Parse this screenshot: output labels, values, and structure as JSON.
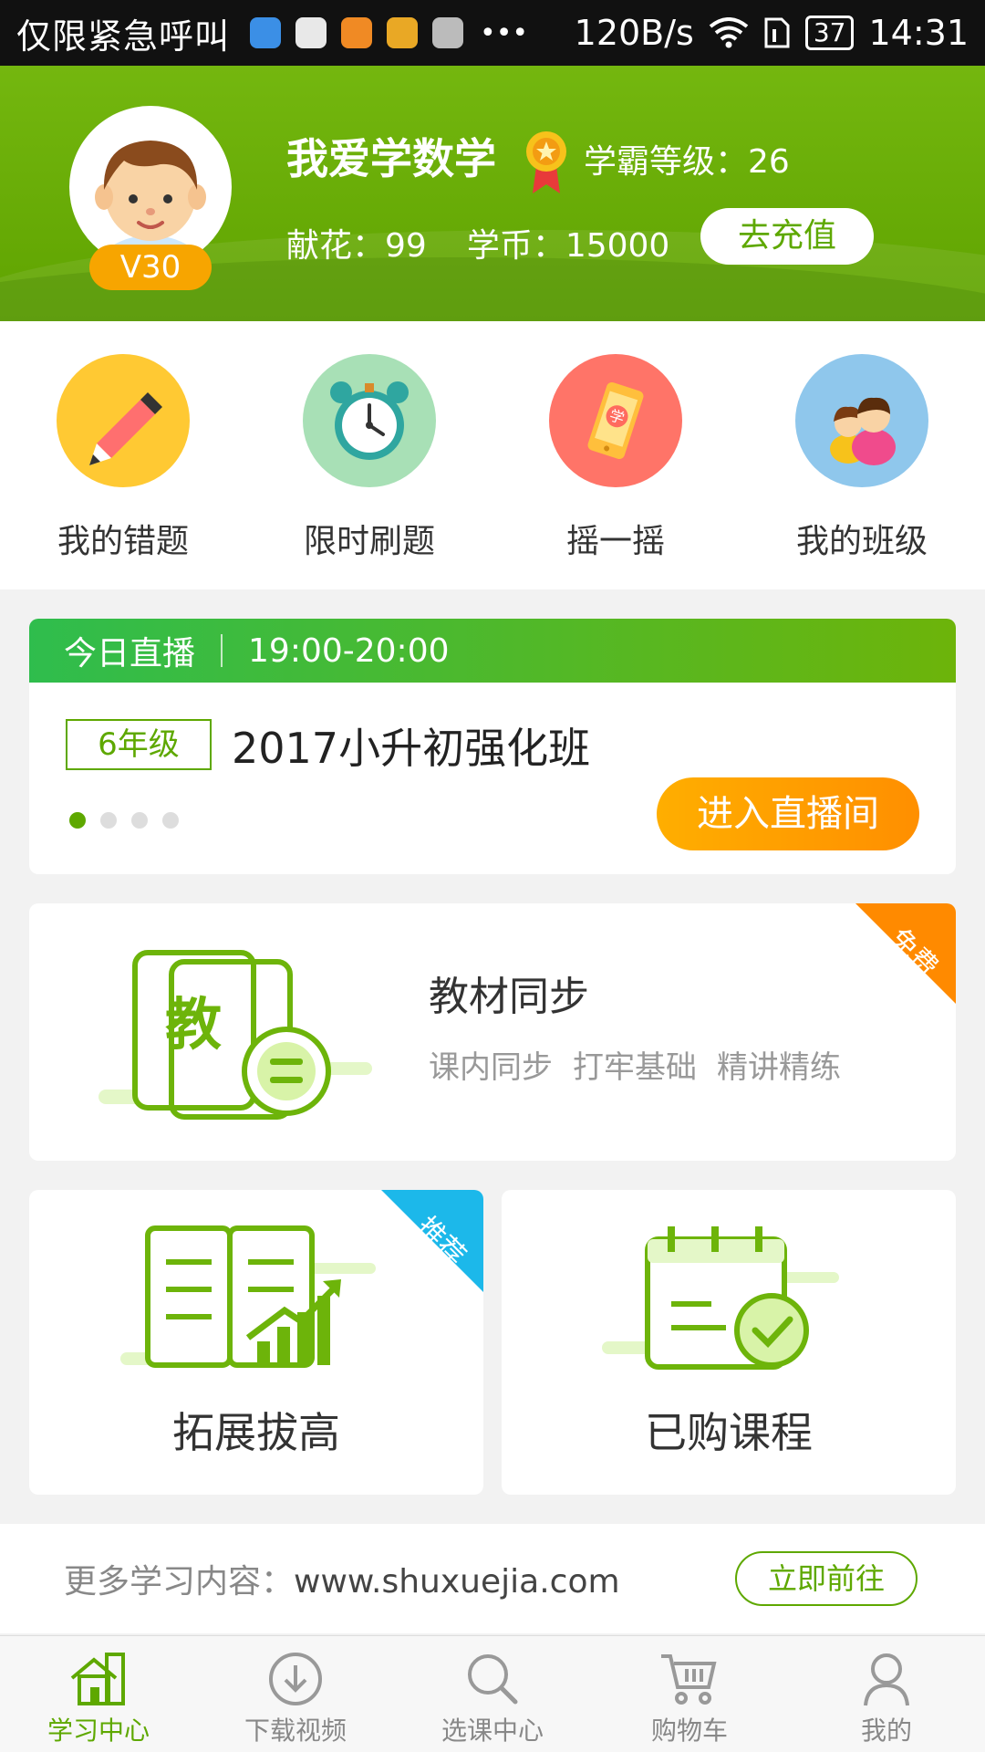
{
  "status_bar": {
    "carrier": "仅限紧急呼叫",
    "speed": "120B/s",
    "battery": "37",
    "time": "14:31"
  },
  "profile": {
    "username": "我爱学数学",
    "level_label": "学霸等级：26",
    "vip": "V30",
    "flowers": "献花：99",
    "coins": "学币：15000",
    "recharge": "去充值"
  },
  "quick_menu": [
    {
      "label": "我的错题",
      "icon": "pencil-icon",
      "color": "#ffc933"
    },
    {
      "label": "限时刷题",
      "icon": "alarm-clock-icon",
      "color": "#7ed39a"
    },
    {
      "label": "摇一摇",
      "icon": "phone-shake-icon",
      "color": "#ff7468"
    },
    {
      "label": "我的班级",
      "icon": "classmates-icon",
      "color": "#8fc7ec"
    }
  ],
  "live": {
    "today_label": "今日直播",
    "time": "19:00-20:00",
    "grade": "6年级",
    "course": "2017小升初强化班",
    "enter_button": "进入直播间"
  },
  "textbook": {
    "title": "教材同步",
    "tags": [
      "课内同步",
      "打牢基础",
      "精讲精练"
    ],
    "badge": "免费",
    "icon_char": "教"
  },
  "extend": {
    "title": "拓展拔高",
    "badge": "推荐"
  },
  "purchased": {
    "title": "已购课程"
  },
  "more": {
    "label": "更多学习内容：",
    "url": "www.shuxuejia.com",
    "go_button": "立即前往"
  },
  "nav": {
    "tabs": [
      "学习中心",
      "下载视频",
      "选课中心",
      "购物车",
      "我的"
    ],
    "active": 0
  },
  "colors": {
    "brand_green": "#5ea800",
    "orange": "#ff8f00",
    "blue_badge": "#1cb8ea"
  }
}
